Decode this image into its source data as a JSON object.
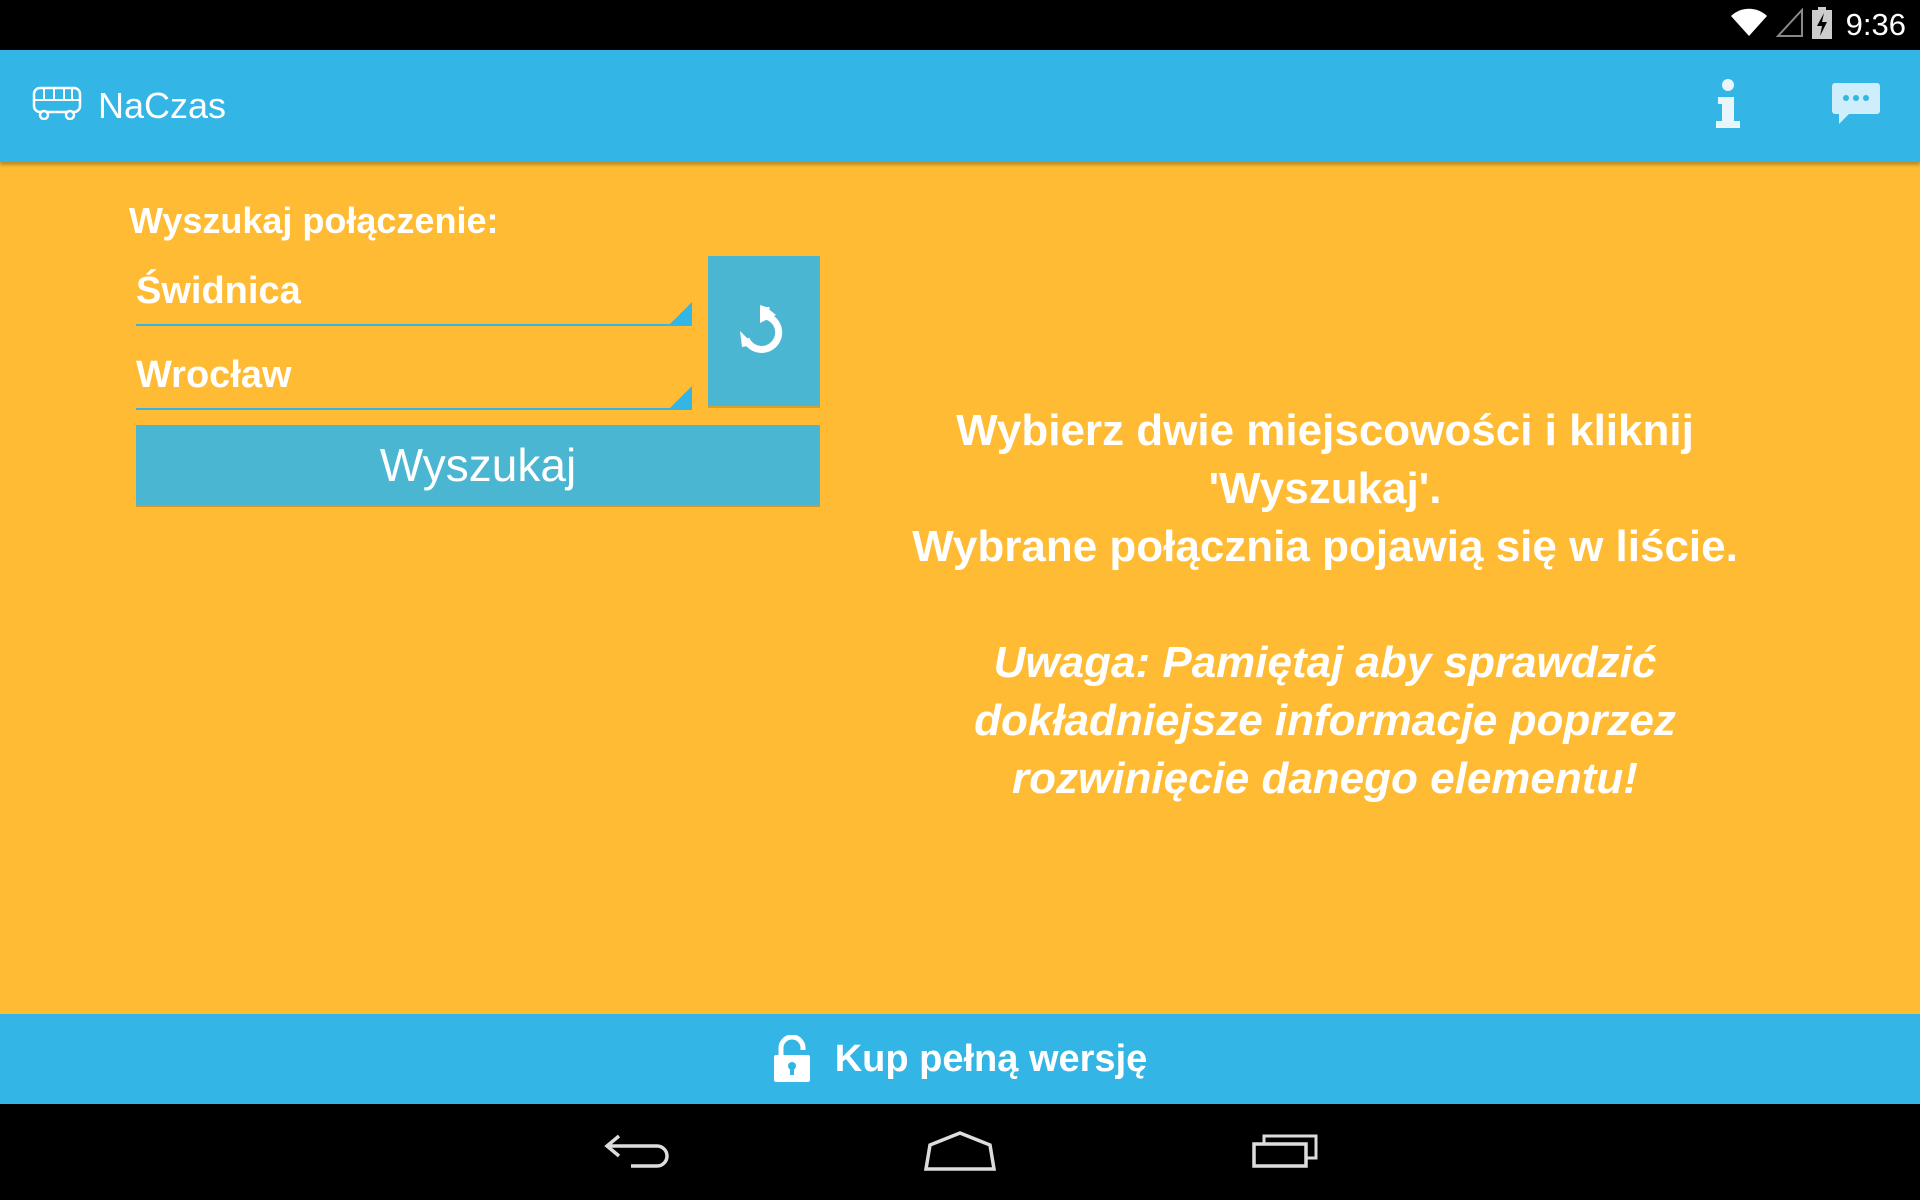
{
  "status_bar": {
    "time": "9:36",
    "icons": [
      "wifi-icon",
      "signal-icon",
      "battery-charging-icon"
    ]
  },
  "action_bar": {
    "app_icon": "bus-icon",
    "title": "NaCzas",
    "actions": [
      {
        "icon": "info-icon"
      },
      {
        "icon": "chat-icon"
      }
    ]
  },
  "search": {
    "label": "Wyszukaj połączenie:",
    "from": "Świdnica",
    "to": "Wrocław",
    "swap_icon": "swap-icon",
    "button_label": "Wyszukaj"
  },
  "instructions": {
    "line1": "Wybierz dwie miejscowości i kliknij 'Wyszukaj'.",
    "line2": "Wybrane połącznia pojawią się w liście.",
    "note": "Uwaga: Pamiętaj aby sprawdzić dokładniejsze informacje poprzez rozwinięcie danego elementu!"
  },
  "buy_bar": {
    "icon": "lock-icon",
    "label": "Kup pełną wersję"
  },
  "nav_bar": {
    "buttons": [
      "back-icon",
      "home-icon",
      "recents-icon"
    ]
  },
  "colors": {
    "action_bar": "#33b5e5",
    "content_background": "#ffbb33",
    "button": "#4bb6d1",
    "text": "#ffffff"
  }
}
